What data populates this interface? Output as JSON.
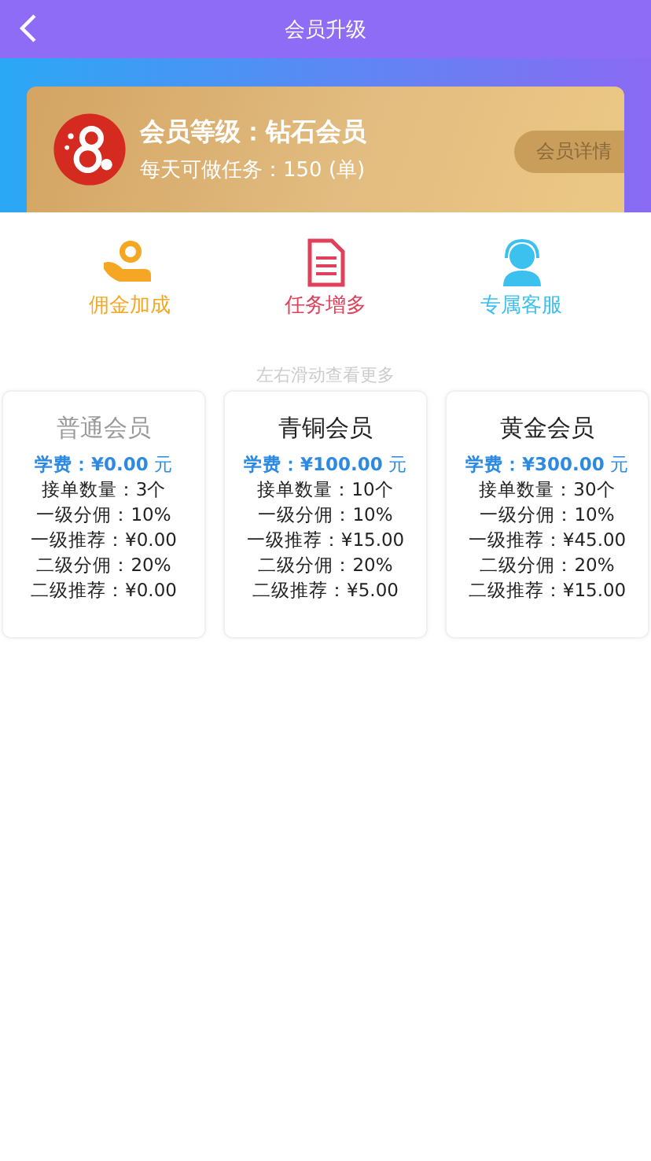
{
  "header": {
    "title": "会员升级"
  },
  "member_card": {
    "level": "会员等级：钻石会员",
    "tasks": "每天可做任务：150 (单)",
    "details_button": "会员详情"
  },
  "features": [
    {
      "kind": "commission",
      "label": "佣金加成"
    },
    {
      "kind": "tasks",
      "label": "任务增多"
    },
    {
      "kind": "service",
      "label": "专属客服"
    }
  ],
  "hint": "左右滑动查看更多",
  "plans": [
    {
      "name": "普通会员",
      "disabled": true,
      "fee": "**学费：¥0.00** 元",
      "lines": [
        "接单数量：3个",
        "一级分佣：10%",
        "一级推荐：¥0.00",
        "二级分佣：20%",
        "二级推荐：¥0.00"
      ]
    },
    {
      "name": "青铜会员",
      "disabled": false,
      "fee": "**学费：¥100.00** 元",
      "lines": [
        "接单数量：10个",
        "一级分佣：10%",
        "一级推荐：¥15.00",
        "二级分佣：20%",
        "二级推荐：¥5.00"
      ]
    },
    {
      "name": "黄金会员",
      "disabled": false,
      "fee": "**学费：¥300.00** 元",
      "lines": [
        "接单数量：30个",
        "一级分佣：10%",
        "一级推荐：¥45.00",
        "二级分佣：20%",
        "二级推荐：¥15.00"
      ]
    }
  ]
}
